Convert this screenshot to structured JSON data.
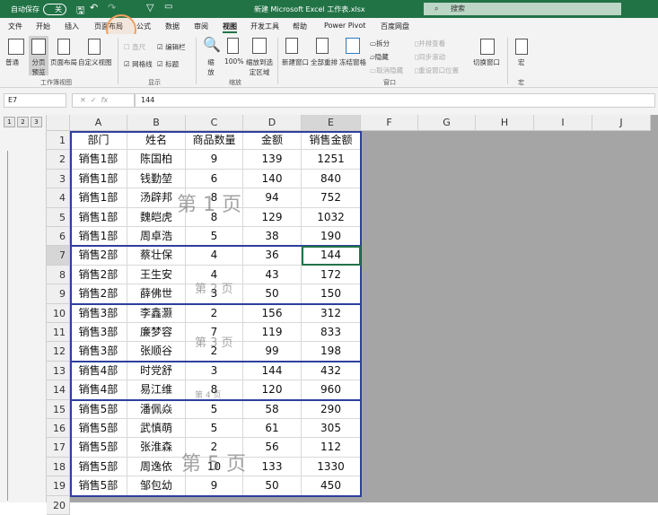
{
  "titlebar": {
    "autosave": "自动保存",
    "autosave_state": "关",
    "title": "新建 Microsoft Excel 工作表.xlsx",
    "search": "搜索"
  },
  "tabs": [
    "文件",
    "开始",
    "插入",
    "页面布局",
    "公式",
    "数据",
    "审阅",
    "视图",
    "开发工具",
    "帮助",
    "Power Pivot",
    "百度网盘"
  ],
  "active_tab": "视图",
  "ribbon": {
    "views": [
      "普通",
      "分页预览",
      "页面布局",
      "自定义视图"
    ],
    "views_group": "工作簿视图",
    "show": {
      "ruler": "直尺",
      "formula_bar": "编辑栏",
      "gridlines": "网格线",
      "headings": "标题",
      "group": "显示"
    },
    "zoom": {
      "zoom": "缩放",
      "zoom100": "100%",
      "zoom_sel": "缩放到选定区域",
      "group": "缩放"
    },
    "window": {
      "new": "新建窗口",
      "arrange": "全部重排",
      "freeze": "冻结窗格",
      "split": "拆分",
      "hide": "隐藏",
      "unhide": "取消隐藏",
      "side": "并排查看",
      "sync": "同步滚动",
      "reset": "重设窗口位置",
      "switch": "切换窗口",
      "group": "窗口"
    },
    "macro": {
      "label": "宏",
      "group": "宏"
    }
  },
  "formula_bar": {
    "name_box": "E7",
    "value": "144"
  },
  "outline_levels": [
    "1",
    "2",
    "3"
  ],
  "columns": [
    "A",
    "B",
    "C",
    "D",
    "E",
    "F",
    "G",
    "H",
    "I",
    "J"
  ],
  "active_cell": "E7",
  "rows": [
    [
      "部门",
      "姓名",
      "商品数量",
      "金额",
      "销售金额"
    ],
    [
      "销售1部",
      "陈国柏",
      "9",
      "139",
      "1251"
    ],
    [
      "销售1部",
      "钱勤堃",
      "6",
      "140",
      "840"
    ],
    [
      "销售1部",
      "汤辟邦",
      "8",
      "94",
      "752"
    ],
    [
      "销售1部",
      "魏皑虎",
      "8",
      "129",
      "1032"
    ],
    [
      "销售1部",
      "周卓浩",
      "5",
      "38",
      "190"
    ],
    [
      "销售2部",
      "蔡壮保",
      "4",
      "36",
      "144"
    ],
    [
      "销售2部",
      "王生安",
      "4",
      "43",
      "172"
    ],
    [
      "销售2部",
      "薛佛世",
      "3",
      "50",
      "150"
    ],
    [
      "销售3部",
      "李鑫灏",
      "2",
      "156",
      "312"
    ],
    [
      "销售3部",
      "廉梦容",
      "7",
      "119",
      "833"
    ],
    [
      "销售3部",
      "张顺谷",
      "2",
      "99",
      "198"
    ],
    [
      "销售4部",
      "时党舒",
      "3",
      "144",
      "432"
    ],
    [
      "销售4部",
      "易江维",
      "8",
      "120",
      "960"
    ],
    [
      "销售5部",
      "潘佩焱",
      "5",
      "58",
      "290"
    ],
    [
      "销售5部",
      "武慎萌",
      "5",
      "61",
      "305"
    ],
    [
      "销售5部",
      "张淮森",
      "2",
      "56",
      "112"
    ],
    [
      "销售5部",
      "周逸依",
      "10",
      "133",
      "1330"
    ],
    [
      "销售5部",
      "邹包幼",
      "9",
      "50",
      "450"
    ],
    [
      "",
      "",
      "",
      "",
      ""
    ]
  ],
  "watermarks": [
    "第 1 页",
    "第 2 页",
    "第 3 页",
    "第 4 页",
    "第 5 页"
  ]
}
